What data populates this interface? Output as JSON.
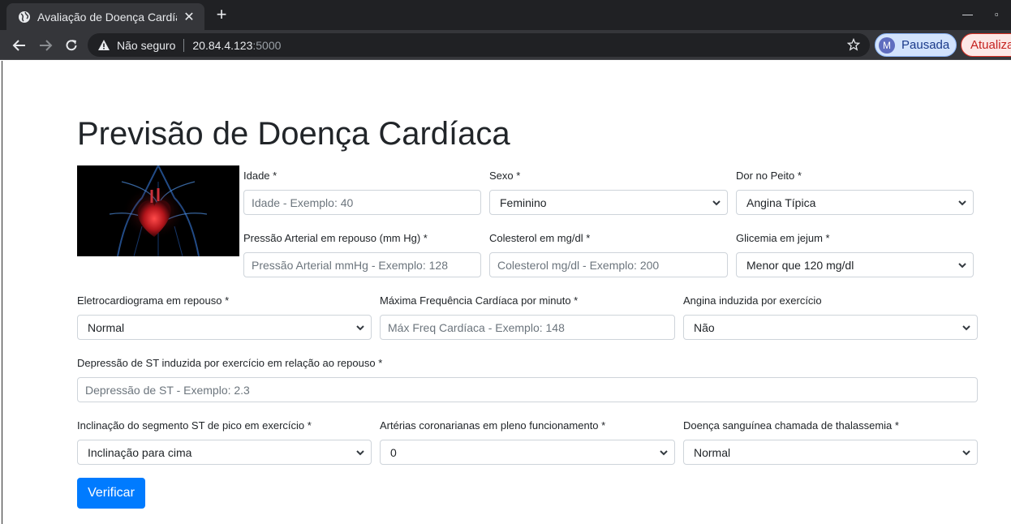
{
  "browser": {
    "tab_title": "Avaliação de Doença Cardíaca",
    "security_label": "Não seguro",
    "url_host": "20.84.4.123",
    "url_port": ":5000",
    "profile_initial": "M",
    "profile_label": "Pausada",
    "update_label": "Atualizar"
  },
  "page": {
    "title": "Previsão de Doença Cardíaca",
    "submit_label": "Verificar"
  },
  "fields": {
    "idade": {
      "label": "Idade *",
      "placeholder": "Idade - Exemplo: 40"
    },
    "sexo": {
      "label": "Sexo *",
      "value": "Feminino"
    },
    "dor_peito": {
      "label": "Dor no Peito *",
      "value": "Angina Típica"
    },
    "pressao": {
      "label": "Pressão Arterial em repouso (mm Hg) *",
      "placeholder": "Pressão Arterial mmHg - Exemplo: 128"
    },
    "colesterol": {
      "label": "Colesterol em mg/dl *",
      "placeholder": "Colesterol mg/dl - Exemplo: 200"
    },
    "glicemia": {
      "label": "Glicemia em jejum *",
      "value": "Menor que 120 mg/dl"
    },
    "eletro": {
      "label": "Eletrocardiograma em repouso *",
      "value": "Normal"
    },
    "freq": {
      "label": "Máxima Frequência Cardíaca por minuto *",
      "placeholder": "Máx Freq Cardíaca - Exemplo: 148"
    },
    "angina": {
      "label": "Angina induzida por exercício",
      "value": "Não"
    },
    "depressao": {
      "label": "Depressão de ST induzida por exercício em relação ao repouso *",
      "placeholder": "Depressão de ST - Exemplo: 2.3"
    },
    "inclinacao": {
      "label": "Inclinação do segmento ST de pico em exercício *",
      "value": "Inclinação para cima"
    },
    "arterias": {
      "label": "Artérias coronarianas em pleno funcionamento *",
      "value": "0"
    },
    "thal": {
      "label": "Doença sanguínea chamada de thalassemia *",
      "value": "Normal"
    }
  }
}
